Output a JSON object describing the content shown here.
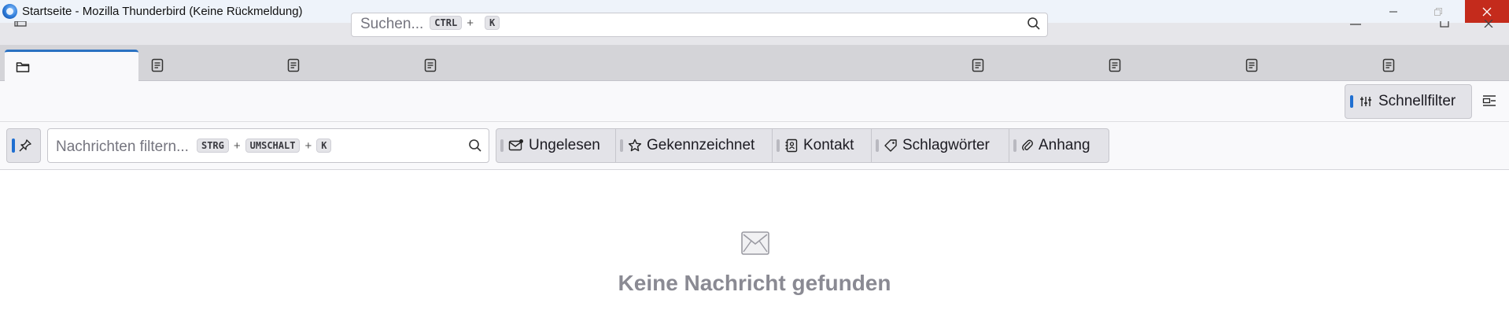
{
  "window": {
    "title": "Startseite - Mozilla Thunderbird (Keine Rückmeldung)"
  },
  "global_search": {
    "placeholder": "Suchen...",
    "shortcut_key1": "CTRL",
    "shortcut_plus": "+",
    "shortcut_key2": "K"
  },
  "tabs": [
    {
      "icon": "folder-icon",
      "active": true
    },
    {
      "icon": "document-icon"
    },
    {
      "icon": "document-icon"
    },
    {
      "icon": "document-icon"
    },
    {
      "icon": "document-icon"
    },
    {
      "icon": "document-icon"
    },
    {
      "icon": "document-icon"
    },
    {
      "icon": "document-icon"
    }
  ],
  "pane_header": {
    "quick_filter_label": "Schnellfilter"
  },
  "filter_bar": {
    "placeholder": "Nachrichten filtern...",
    "key1": "STRG",
    "plus1": "+",
    "key2": "UMSCHALT",
    "plus2": "+",
    "key3": "K",
    "buttons": {
      "unread": "Ungelesen",
      "starred": "Gekennzeichnet",
      "contact": "Kontakt",
      "tags": "Schlagwörter",
      "attachment": "Anhang"
    }
  },
  "empty_state": {
    "text": "Keine Nachricht gefunden"
  },
  "colors": {
    "accent": "#1f6fd1",
    "close_button": "#c42b1c",
    "active_tab_border": "#2b72c2"
  }
}
